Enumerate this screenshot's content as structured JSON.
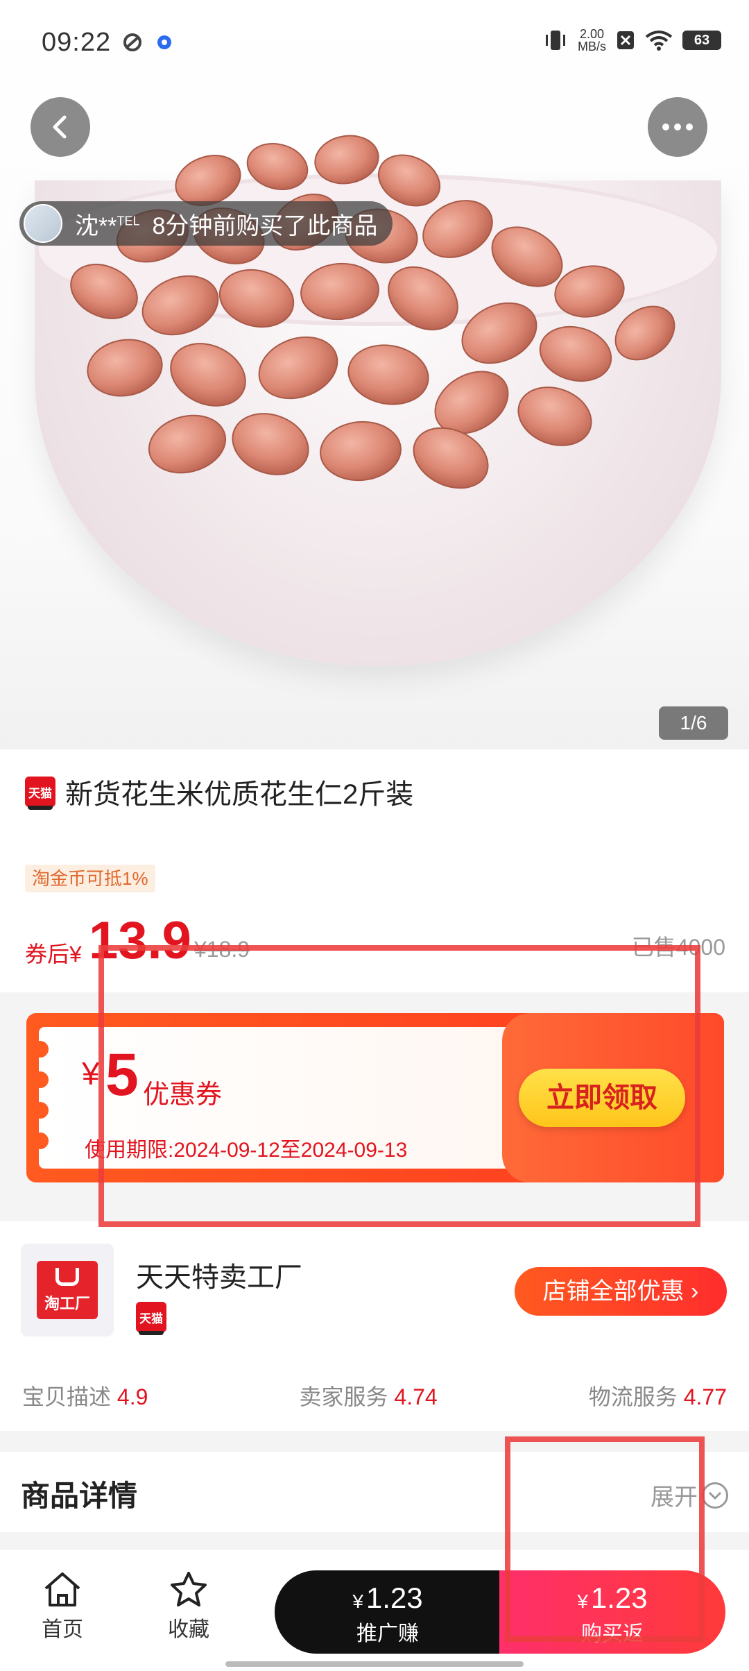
{
  "status_bar": {
    "time": "09:22",
    "net_speed_value": "2.00",
    "net_speed_unit": "MB/s",
    "battery": "63"
  },
  "hero": {
    "buyer_name": "沈**",
    "buyer_name_suffix": "TEL",
    "buyer_action": "8分钟前购买了此商品",
    "page_indicator": "1/6"
  },
  "product": {
    "badge": "天猫",
    "title": "新货花生米优质花生仁2斤装",
    "coin_tag": "淘金币可抵1%",
    "price_after_label": "券后¥",
    "price": "13.9",
    "original_price": "¥18.9",
    "sold": "已售4000"
  },
  "coupon": {
    "yen": "¥",
    "amount": "5",
    "label": "优惠券",
    "validity": "使用期限:2024-09-12至2024-09-13",
    "button": "立即领取"
  },
  "store": {
    "logo_text": "淘工厂",
    "name": "天天特卖工厂",
    "badge": "天猫",
    "all_offers": "店铺全部优惠 ›",
    "ratings": [
      {
        "label": "宝贝描述",
        "value": "4.9"
      },
      {
        "label": "卖家服务",
        "value": "4.74"
      },
      {
        "label": "物流服务",
        "value": "4.77"
      }
    ]
  },
  "detail": {
    "title": "商品详情",
    "expand": "展开"
  },
  "bottom_bar": {
    "home": "首页",
    "favorite": "收藏",
    "promo_currency": "¥",
    "promo_price": "1.23",
    "promo_label": "推广赚",
    "buy_currency": "¥",
    "buy_price": "1.23",
    "buy_label": "购买返"
  },
  "colors": {
    "accent_red": "#e1141f",
    "coupon_orange": "#ff5a1f",
    "buy_pink": "#ff2f6b",
    "annotation_red": "#ec3c3c"
  },
  "icons": [
    "back-icon",
    "more-icon",
    "chevron-down-icon",
    "home-icon",
    "star-icon"
  ]
}
